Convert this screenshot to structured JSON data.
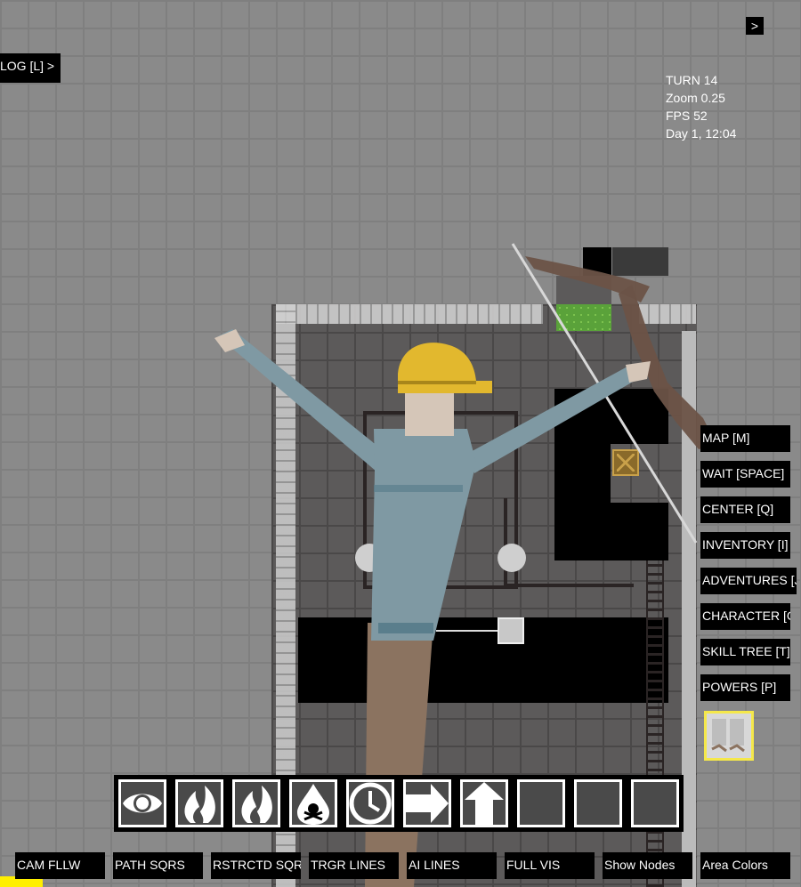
{
  "hud": {
    "turn": "TURN 14",
    "zoom": "Zoom 0.25",
    "fps": "FPS 52",
    "time": "Day 1, 12:04"
  },
  "top_right_toggle": ">",
  "log_button": "LOG [L] >",
  "side_menu": [
    {
      "label": "MAP [M]"
    },
    {
      "label": "WAIT [SPACE]"
    },
    {
      "label": "CENTER [Q]"
    },
    {
      "label": "INVENTORY [I]"
    },
    {
      "label": "ADVENTURES [J]"
    },
    {
      "label": "CHARACTER [C]"
    },
    {
      "label": "SKILL TREE [T]"
    },
    {
      "label": "POWERS [P]"
    }
  ],
  "hotbar": [
    {
      "icon": "eye-icon"
    },
    {
      "icon": "fire-icon"
    },
    {
      "icon": "fire-icon"
    },
    {
      "icon": "poison-drop-icon"
    },
    {
      "icon": "clock-icon"
    },
    {
      "icon": "arrow-right-icon"
    },
    {
      "icon": "arrow-up-icon"
    },
    {
      "icon": "empty-slot"
    },
    {
      "icon": "empty-slot"
    },
    {
      "icon": "empty-slot"
    }
  ],
  "debug_buttons": [
    {
      "label": "CAM FLLW"
    },
    {
      "label": "PATH SQRS"
    },
    {
      "label": "RSTRCTD SQRS"
    },
    {
      "label": "TRGR LINES"
    },
    {
      "label": "AI LINES"
    },
    {
      "label": "FULL VIS"
    },
    {
      "label": "Show Nodes"
    },
    {
      "label": "Area Colors"
    }
  ],
  "colors": {
    "background": "#8a8a8a",
    "panel": "#000000",
    "text": "#ffffff",
    "highlight": "#f5e84a",
    "helmet": "#e2b82e",
    "sweater": "#7f99a3"
  }
}
